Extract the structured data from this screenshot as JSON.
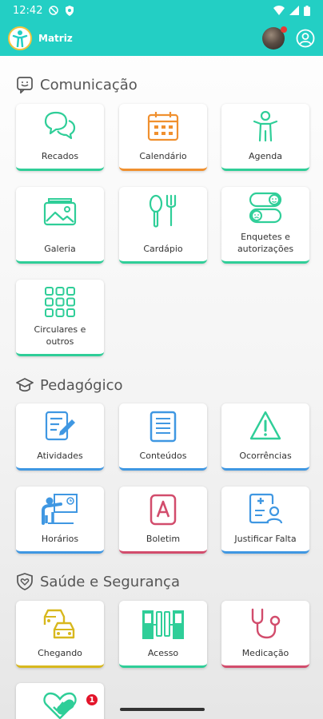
{
  "status_bar": {
    "time": "12:42"
  },
  "app_bar": {
    "title": "Matriz"
  },
  "colors": {
    "primary": "#23cfc4",
    "green": "#2fce98",
    "orange": "#f0902f",
    "blue": "#3f97e2",
    "red": "#d24c6c",
    "yellow": "#d8b81e"
  },
  "sections": {
    "comunicacao": {
      "title": "Comunicação",
      "items": [
        {
          "label": "Recados",
          "icon": "chat-icon"
        },
        {
          "label": "Calendário",
          "icon": "calendar-icon"
        },
        {
          "label": "Agenda",
          "icon": "child-icon"
        },
        {
          "label": "Galeria",
          "icon": "gallery-icon"
        },
        {
          "label": "Cardápio",
          "icon": "cutlery-icon"
        },
        {
          "label": "Enquetes e autorizações",
          "icon": "poll-toggle-icon"
        },
        {
          "label": "Circulares e outros",
          "icon": "grid-icon"
        }
      ]
    },
    "pedagogico": {
      "title": "Pedagógico",
      "items": [
        {
          "label": "Atividades",
          "icon": "edit-document-icon"
        },
        {
          "label": "Conteúdos",
          "icon": "content-list-icon"
        },
        {
          "label": "Ocorrências",
          "icon": "warning-icon"
        },
        {
          "label": "Horários",
          "icon": "teacher-board-icon"
        },
        {
          "label": "Boletim",
          "icon": "report-card-icon"
        },
        {
          "label": "Justificar Falta",
          "icon": "justify-absence-icon"
        }
      ]
    },
    "saude": {
      "title": "Saúde e Segurança",
      "items": [
        {
          "label": "Chegando",
          "icon": "cars-icon"
        },
        {
          "label": "Acesso",
          "icon": "turnstile-icon"
        },
        {
          "label": "Medicação",
          "icon": "stethoscope-icon"
        },
        {
          "label": "",
          "icon": "health-pill-icon",
          "badge": "1"
        }
      ]
    }
  }
}
